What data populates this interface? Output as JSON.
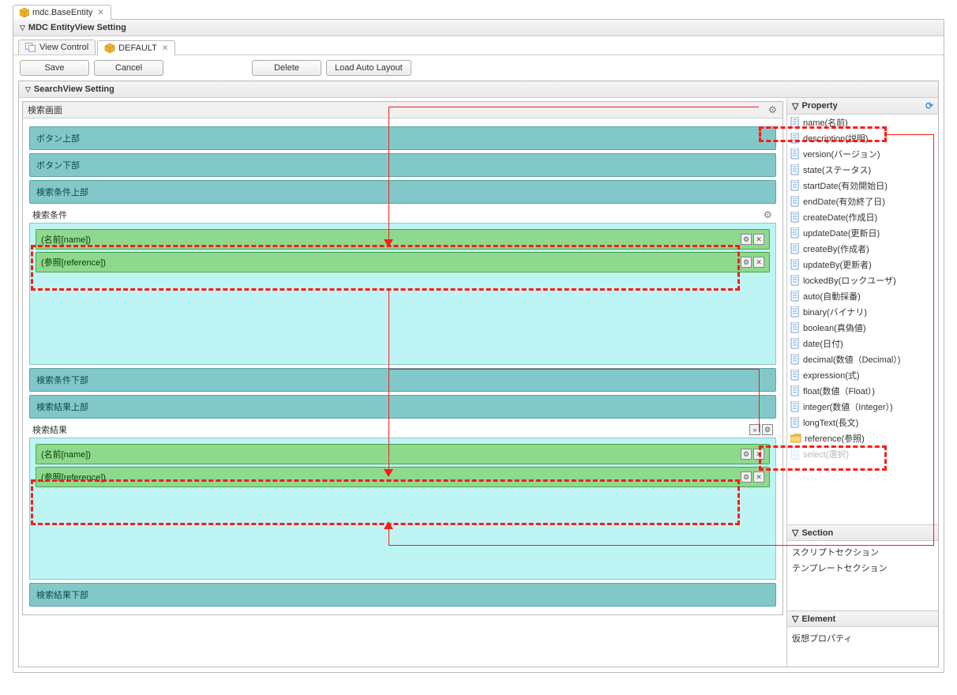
{
  "mainTab": {
    "title": "mdc.BaseEntity"
  },
  "panelTitle": "MDC EntityView Setting",
  "subTabs": {
    "viewControl": "View Control",
    "default": "DEFAULT"
  },
  "buttons": {
    "save": "Save",
    "cancel": "Cancel",
    "delete": "Delete",
    "loadAutoLayout": "Load Auto Layout"
  },
  "searchViewTitle": "SearchView Setting",
  "layout": {
    "screenTitle": "検索画面",
    "buttonTop": "ボタン上部",
    "buttonBottom": "ボタン下部",
    "condTop": "検索条件上部",
    "condBottom": "検索条件下部",
    "condLabel": "検索条件",
    "resultTop": "検索結果上部",
    "resultLabel": "検索結果",
    "resultBottom": "検索結果下部"
  },
  "chips": {
    "nameChip": "(名前[name])",
    "refChip": "(参照[reference])"
  },
  "side": {
    "propertyTitle": "Property",
    "sectionTitle": "Section",
    "elementTitle": "Element",
    "scriptSection": "スクリプトセクション",
    "templateSection": "テンプレートセクション",
    "virtualProperty": "仮想プロパティ"
  },
  "properties": [
    "name(名前)",
    "description(説明)",
    "version(バージョン)",
    "state(ステータス)",
    "startDate(有効開始日)",
    "endDate(有効終了日)",
    "createDate(作成日)",
    "updateDate(更新日)",
    "createBy(作成者)",
    "updateBy(更新者)",
    "lockedBy(ロックユーザ)",
    "auto(自動採番)",
    "binary(バイナリ)",
    "boolean(真偽値)",
    "date(日付)",
    "decimal(数値（Decimal）)",
    "expression(式)",
    "float(数値（Float）)",
    "integer(数値（Integer）)",
    "longText(長文)"
  ],
  "referenceProp": "reference(参照)",
  "selectProp": "select(選択)"
}
